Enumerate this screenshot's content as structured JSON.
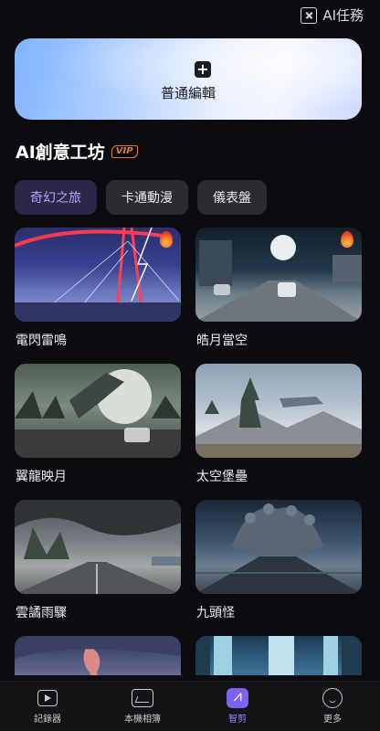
{
  "header": {
    "ai_tasks_label": "AI任務",
    "ai_tasks_icon": "ai-task-icon"
  },
  "hero": {
    "icon": "plus-icon",
    "label": "普通編輯"
  },
  "section": {
    "title": "AI創意工坊",
    "badge": "VIP"
  },
  "tabs": [
    {
      "label": "奇幻之旅",
      "active": true
    },
    {
      "label": "卡通動漫",
      "active": false
    },
    {
      "label": "儀表盤",
      "active": false
    }
  ],
  "cards": [
    {
      "title": "電閃雷鳴",
      "hot": true
    },
    {
      "title": "皓月當空",
      "hot": true
    },
    {
      "title": "翼龍映月",
      "hot": false
    },
    {
      "title": "太空堡壘",
      "hot": false
    },
    {
      "title": "雲譎雨驟",
      "hot": false
    },
    {
      "title": "九頭怪",
      "hot": false
    },
    {
      "title": "",
      "hot": false
    },
    {
      "title": "",
      "hot": false
    }
  ],
  "nav": [
    {
      "label": "記錄器",
      "icon": "recorder-icon",
      "active": false
    },
    {
      "label": "本機相簿",
      "icon": "album-icon",
      "active": false
    },
    {
      "label": "智剪",
      "icon": "smart-edit-icon",
      "active": true
    },
    {
      "label": "更多",
      "icon": "more-icon",
      "active": false
    }
  ],
  "colors": {
    "accent": "#9b82ff",
    "background": "#0c0c10",
    "vip": "#e07a3a"
  }
}
